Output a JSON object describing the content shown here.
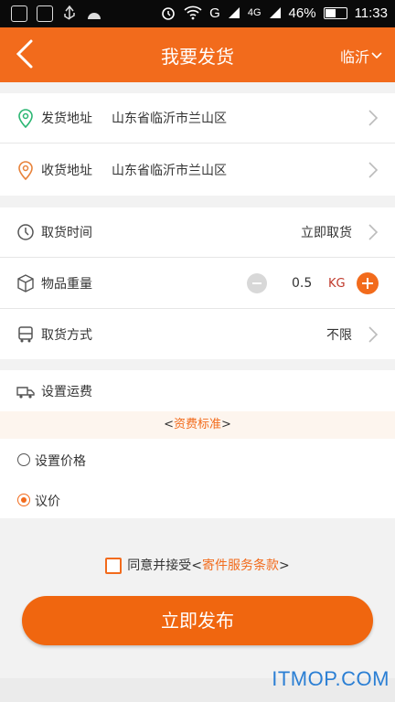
{
  "status_bar": {
    "signal_label": "G",
    "network_label": "4G",
    "battery_percent": "46%",
    "time": "11:33"
  },
  "header": {
    "title": "我要发货",
    "city": "临沂",
    "back_icon": "chevron-left-icon"
  },
  "address": {
    "sender_label": "发货地址",
    "sender_value": "山东省临沂市兰山区",
    "receiver_label": "收货地址",
    "receiver_value": "山东省临沂市兰山区"
  },
  "pickup": {
    "time_label": "取货时间",
    "time_value": "立即取货",
    "weight_label": "物品重量",
    "weight_value": "0.5",
    "weight_unit": "KG",
    "method_label": "取货方式",
    "method_value": "不限"
  },
  "fee": {
    "title": "设置运费",
    "standard_prefix": "<",
    "standard_link": "资费标准",
    "standard_suffix": ">",
    "option_set_price": "设置价格",
    "option_negotiate": "议价",
    "selected": "议价"
  },
  "agreement": {
    "text": "同意并接受<",
    "link": "寄件服务条款",
    "suffix": ">"
  },
  "publish_button": "立即发布",
  "watermark": "ITMOP.COM",
  "colors": {
    "brand": "#f26b1c",
    "green_pin": "#2bb673",
    "orange_pin": "#e8823a"
  }
}
